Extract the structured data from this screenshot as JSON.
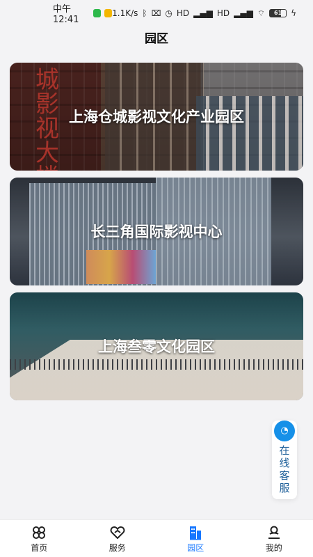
{
  "status": {
    "time": "中午12:41",
    "network_speed": "1.1K/s",
    "signal_1": "HD",
    "signal_2": "HD",
    "battery": "61"
  },
  "header": {
    "title": "园区"
  },
  "parks": [
    {
      "title": "上海仓城影视文化产业园区"
    },
    {
      "title": "长三角国际影视中心"
    },
    {
      "title": "上海叁零文化园区"
    }
  ],
  "service": {
    "label": "在线客服"
  },
  "tabs": [
    {
      "label": "首页",
      "icon": "home-icon"
    },
    {
      "label": "服务",
      "icon": "service-icon"
    },
    {
      "label": "园区",
      "icon": "park-icon",
      "active": true
    },
    {
      "label": "我的",
      "icon": "profile-icon"
    }
  ],
  "colors": {
    "accent": "#1677ff",
    "service_icon": "#1690e8",
    "background": "#f3f3f5"
  }
}
